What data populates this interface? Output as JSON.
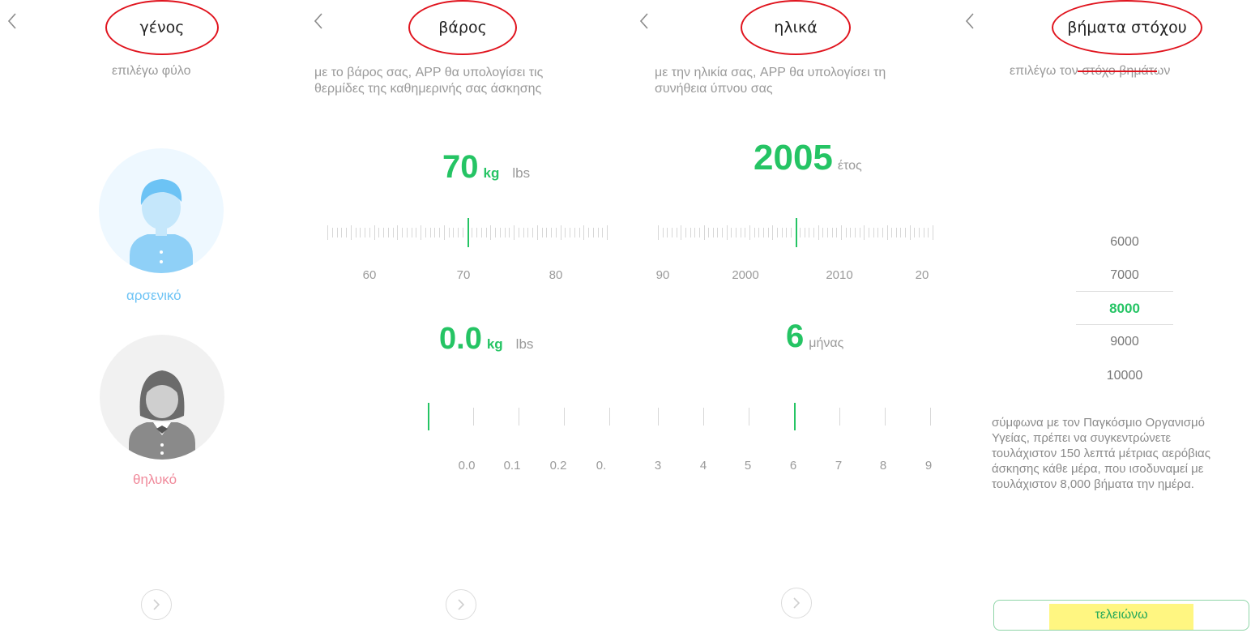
{
  "gender": {
    "title": "γένος",
    "subtitle": "επιλέγω φύλο",
    "male_label": "αρσενικό",
    "female_label": "θηλυκό"
  },
  "weight": {
    "title": "βάρος",
    "subtitle_line1": "με το βάρος σας, APP θα υπολογίσει τις",
    "subtitle_line2": "θερμίδες της καθημερινής σας άσκησης",
    "value": "70",
    "unit_selected": "kg",
    "unit_alt": "lbs",
    "ruler_labels": [
      "60",
      "70",
      "80"
    ],
    "fraction_value": "0.0",
    "fraction_unit_selected": "kg",
    "fraction_unit_alt": "lbs",
    "fraction_labels": [
      "0.0",
      "0.1",
      "0.2",
      "0."
    ]
  },
  "age": {
    "title": "ηλικά",
    "subtitle_line1": "με την ηλικία σας, APP θα υπολογίσει τη",
    "subtitle_line2": "συνήθεια ύπνου σας",
    "year_value": "2005",
    "year_unit": "έτος",
    "year_labels": [
      "90",
      "2000",
      "2010",
      "20"
    ],
    "month_value": "6",
    "month_unit": "μήνας",
    "month_labels": [
      "3",
      "4",
      "5",
      "6",
      "7",
      "8",
      "9"
    ]
  },
  "steps": {
    "title": "βήματα στόχου",
    "subtitle": "επιλέγω τον στόχο βημάτων",
    "options": [
      "6000",
      "7000",
      "8000",
      "9000",
      "10000"
    ],
    "selected": "8000",
    "who_text": [
      "σύμφωνα με τον Παγκόσμιο Οργανισμό",
      "Υγείας, πρέπει να συγκεντρώνετε",
      "τουλάχιστον 150 λεπτά μέτριας αερόβιας",
      "άσκησης κάθε μέρα, που ισοδυναμεί με",
      "τουλάχιστον 8,000 βήματα την ημέρα."
    ],
    "done_label": "τελειώνω"
  },
  "colors": {
    "accent": "#25c464",
    "male": "#6cc3f5",
    "female": "#f08a9b",
    "annotation": "#e0141e",
    "highlight": "#fff46b"
  }
}
